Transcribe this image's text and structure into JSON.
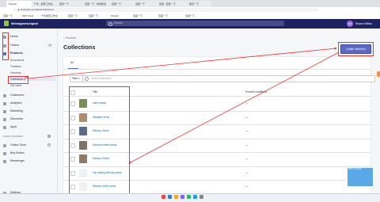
{
  "browser": {
    "tabs": [
      "Shopify",
      "千牛 - 卖家工作台",
      "首页一下",
      "百度一下，你就知道",
      "百度一下",
      "百度一下",
      "百度 - 百度一下",
      "首页一下"
    ],
    "url": "▲ mshopify.com/admin/collections",
    "bookmarks": [
      "百度一下",
      "SEO Tools",
      "千牛卖家工作台",
      "百度一下",
      "百度一下",
      "Shopify",
      "百度一下",
      "百度一下",
      "百度一下"
    ]
  },
  "topbar": {
    "shop_name": "Melodypantsoriginal",
    "search_placeholder": "Search",
    "avatar_initials": "SM",
    "user_name": "Shawn Milton"
  },
  "sidebar": {
    "items": [
      {
        "label": "Home"
      },
      {
        "label": "Orders"
      },
      {
        "label": "Products"
      }
    ],
    "orders_badge": "2",
    "product_subitems": [
      "All products",
      "Transfers",
      "Inventory",
      "Collections",
      "Gift cards"
    ],
    "items2": [
      {
        "label": "Customers"
      },
      {
        "label": "Analytics"
      },
      {
        "label": "Marketing"
      },
      {
        "label": "Discounts"
      },
      {
        "label": "Apps"
      }
    ],
    "sales_channels_heading": "SALES CHANNELS",
    "channels": [
      {
        "label": "Online Store"
      },
      {
        "label": "Buy Button"
      },
      {
        "label": "Messenger"
      }
    ],
    "settings_label": "Settings"
  },
  "main": {
    "breadcrumb": "< Products",
    "title": "Collections",
    "create_button": "Create collection",
    "tab_all": "All",
    "filter_label": "Filter ▾",
    "search_placeholder": "Search collections",
    "columns": {
      "title": "Title",
      "conditions": "Product conditions"
    },
    "rows": [
      {
        "title": "camo pants",
        "conditions": "—",
        "color": "#7a8f56"
      },
      {
        "title": "Weather items",
        "conditions": "—",
        "color": "#b08c6d"
      },
      {
        "title": "Melody Jeans",
        "conditions": "—",
        "color": "#5c6b87"
      },
      {
        "title": "Melody knitted pants",
        "conditions": "—",
        "color": "#7d7168"
      },
      {
        "title": "Melody Shorts",
        "conditions": "—",
        "color": "#8f7a6a"
      },
      {
        "title": "Top-selling Melody pants",
        "conditions": "—",
        "color": "#eef0f2"
      },
      {
        "title": "Melody velvet pants",
        "conditions": "—",
        "color": "#eef0f2"
      }
    ]
  },
  "overlay": {
    "video_label": "PHM YA! RAIN"
  },
  "colors": {
    "topbar": "#1c2260",
    "accent": "#5c6ac4",
    "annotation": "#ee3333"
  }
}
